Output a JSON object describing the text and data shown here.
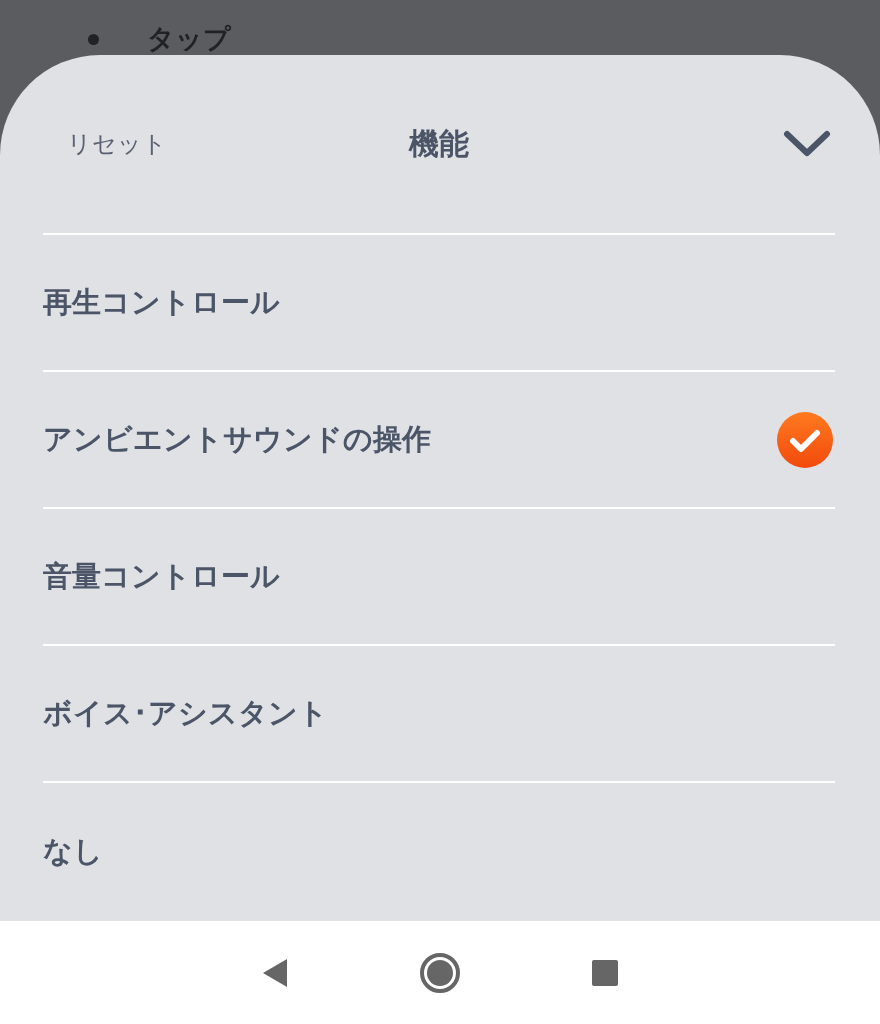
{
  "background": {
    "list_items": [
      "タップ"
    ]
  },
  "sheet": {
    "reset_label": "リセット",
    "title": "機能",
    "options": [
      {
        "label": "再生コントロール",
        "selected": false
      },
      {
        "label": "アンビエントサウンドの操作",
        "selected": true
      },
      {
        "label": "音量コントロール",
        "selected": false
      },
      {
        "label": "ボイス･アシスタント",
        "selected": false
      },
      {
        "label": "なし",
        "selected": false
      }
    ]
  }
}
